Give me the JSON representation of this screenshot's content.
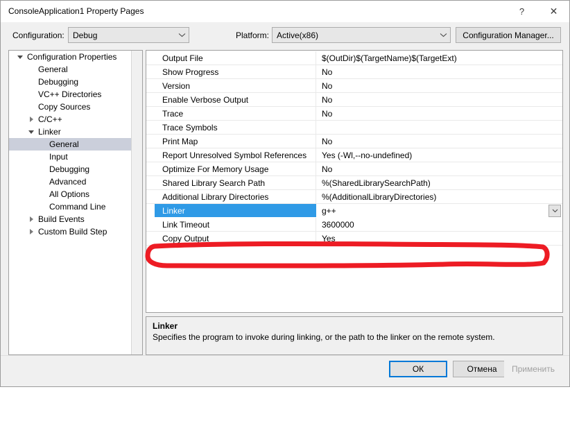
{
  "window": {
    "title": "ConsoleApplication1 Property Pages",
    "help_glyph": "?",
    "close_glyph": "✕"
  },
  "config_bar": {
    "configuration_label": "Configuration:",
    "configuration_value": "Debug",
    "platform_label": "Platform:",
    "platform_value": "Active(x86)",
    "configuration_manager_label": "Configuration Manager..."
  },
  "tree": {
    "items": [
      {
        "label": "Configuration Properties",
        "indent": 0,
        "expander": "expanded",
        "selected": false
      },
      {
        "label": "General",
        "indent": 1,
        "expander": "none",
        "selected": false
      },
      {
        "label": "Debugging",
        "indent": 1,
        "expander": "none",
        "selected": false
      },
      {
        "label": "VC++ Directories",
        "indent": 1,
        "expander": "none",
        "selected": false
      },
      {
        "label": "Copy Sources",
        "indent": 1,
        "expander": "none",
        "selected": false
      },
      {
        "label": "C/C++",
        "indent": 1,
        "expander": "collapsed",
        "selected": false
      },
      {
        "label": "Linker",
        "indent": 1,
        "expander": "expanded",
        "selected": false
      },
      {
        "label": "General",
        "indent": 2,
        "expander": "none",
        "selected": true
      },
      {
        "label": "Input",
        "indent": 2,
        "expander": "none",
        "selected": false
      },
      {
        "label": "Debugging",
        "indent": 2,
        "expander": "none",
        "selected": false
      },
      {
        "label": "Advanced",
        "indent": 2,
        "expander": "none",
        "selected": false
      },
      {
        "label": "All Options",
        "indent": 2,
        "expander": "none",
        "selected": false
      },
      {
        "label": "Command Line",
        "indent": 2,
        "expander": "none",
        "selected": false
      },
      {
        "label": "Build Events",
        "indent": 1,
        "expander": "collapsed",
        "selected": false
      },
      {
        "label": "Custom Build Step",
        "indent": 1,
        "expander": "collapsed",
        "selected": false
      }
    ]
  },
  "grid": {
    "rows": [
      {
        "name": "Output File",
        "value": "$(OutDir)$(TargetName)$(TargetExt)",
        "selected": false
      },
      {
        "name": "Show Progress",
        "value": "No",
        "selected": false
      },
      {
        "name": "Version",
        "value": "No",
        "selected": false
      },
      {
        "name": "Enable Verbose Output",
        "value": "No",
        "selected": false
      },
      {
        "name": "Trace",
        "value": "No",
        "selected": false
      },
      {
        "name": "Trace Symbols",
        "value": "",
        "selected": false
      },
      {
        "name": "Print Map",
        "value": "No",
        "selected": false
      },
      {
        "name": "Report Unresolved Symbol References",
        "value": "Yes (-Wl,--no-undefined)",
        "selected": false
      },
      {
        "name": "Optimize For Memory Usage",
        "value": "No",
        "selected": false
      },
      {
        "name": "Shared Library Search Path",
        "value": "%(SharedLibrarySearchPath)",
        "selected": false
      },
      {
        "name": "Additional Library Directories",
        "value": "%(AdditionalLibraryDirectories)",
        "selected": false
      },
      {
        "name": "Linker",
        "value": "g++",
        "selected": true
      },
      {
        "name": "Link Timeout",
        "value": "3600000",
        "selected": false
      },
      {
        "name": "Copy Output",
        "value": "Yes",
        "selected": false
      }
    ],
    "selected_row_index": 11
  },
  "description": {
    "title": "Linker",
    "text": "Specifies the program to invoke during linking, or the path to the linker on the remote system."
  },
  "footer": {
    "ok_label": "ОК",
    "cancel_label": "Отмена",
    "apply_label": "Применить"
  },
  "colors": {
    "selection_blue": "#2f9ae6",
    "tree_selection": "#cbcfdb",
    "annotation_red": "#ed1c24",
    "focus_blue": "#0078d7"
  }
}
